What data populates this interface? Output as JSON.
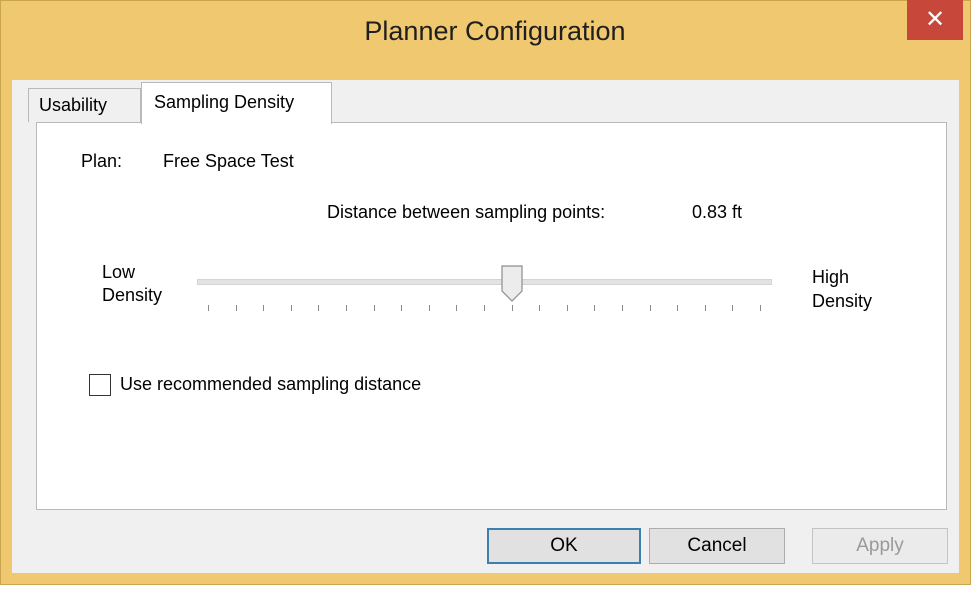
{
  "window": {
    "title": "Planner Configuration",
    "close_glyph": "✕",
    "frame_color": "#f0c870",
    "close_color": "#c7483a"
  },
  "tabs": [
    {
      "label": "Usability",
      "selected": false
    },
    {
      "label": "Sampling Density",
      "selected": true
    }
  ],
  "panel": {
    "plan_label": "Plan:",
    "plan_value": "Free Space Test",
    "distance_label": "Distance between sampling points:",
    "distance_value": "0.83 ft",
    "slider": {
      "low_label_line1": "Low",
      "low_label_line2": "Density",
      "high_label_line1": "High",
      "high_label_line2": "Density",
      "position_fraction": 0.55,
      "tick_count": 20
    },
    "checkbox": {
      "label": "Use recommended sampling distance",
      "checked": false
    }
  },
  "buttons": {
    "ok": "OK",
    "cancel": "Cancel",
    "apply": "Apply",
    "apply_enabled": false
  }
}
